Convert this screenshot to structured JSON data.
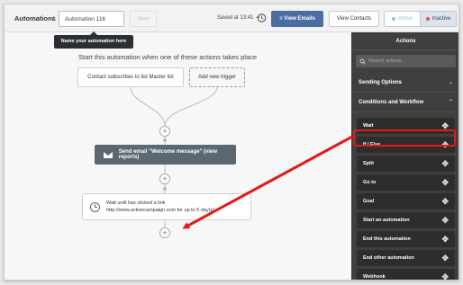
{
  "header": {
    "breadcrumb": "Automations",
    "separator": "/",
    "name_value": "Automation 116",
    "save_label": "Save",
    "saved_text": "Saved at 13:41",
    "history_icon": "history-icon",
    "view_emails_label": "View Emails",
    "view_contacts_label": "View Contacts",
    "status_toggle": {
      "active_label": "Active",
      "inactive_label": "Inactive",
      "selected": "Inactive"
    }
  },
  "tooltip": {
    "text": "Name your automation here"
  },
  "canvas": {
    "headline": "Start this automation when one of these actions takes place",
    "trigger_label": "Contact subscribes to list Master list",
    "add_trigger_label": "Add new trigger",
    "email_action": "Send email \"Welcome message\" (view reports)",
    "wait_line1": "Wait until has clicked a link",
    "wait_line2": "http://www.activecampaign.com for up to 5 day(s)",
    "plus_symbol": "+"
  },
  "sidebar": {
    "title": "Actions",
    "search_placeholder": "Search actions...",
    "sections": [
      {
        "label": "Sending Options",
        "chevron": "⌄"
      },
      {
        "label": "Conditions and Workflow",
        "chevron": "⌃"
      }
    ],
    "items": [
      {
        "label": "Wait"
      },
      {
        "label": "If / Else"
      },
      {
        "label": "Split"
      },
      {
        "label": "Go to"
      },
      {
        "label": "Goal"
      },
      {
        "label": "Start an automation"
      },
      {
        "label": "End this automation"
      },
      {
        "label": "End other automation"
      },
      {
        "label": "Webhook"
      }
    ],
    "move_symbol": "✥"
  },
  "colors": {
    "primary_button": "#4a6ea2",
    "sidebar_bg": "#3f3f3f",
    "annotation_red": "#e01b1b",
    "active_green": "#5cb85c",
    "inactive_red": "#e74c5c"
  }
}
